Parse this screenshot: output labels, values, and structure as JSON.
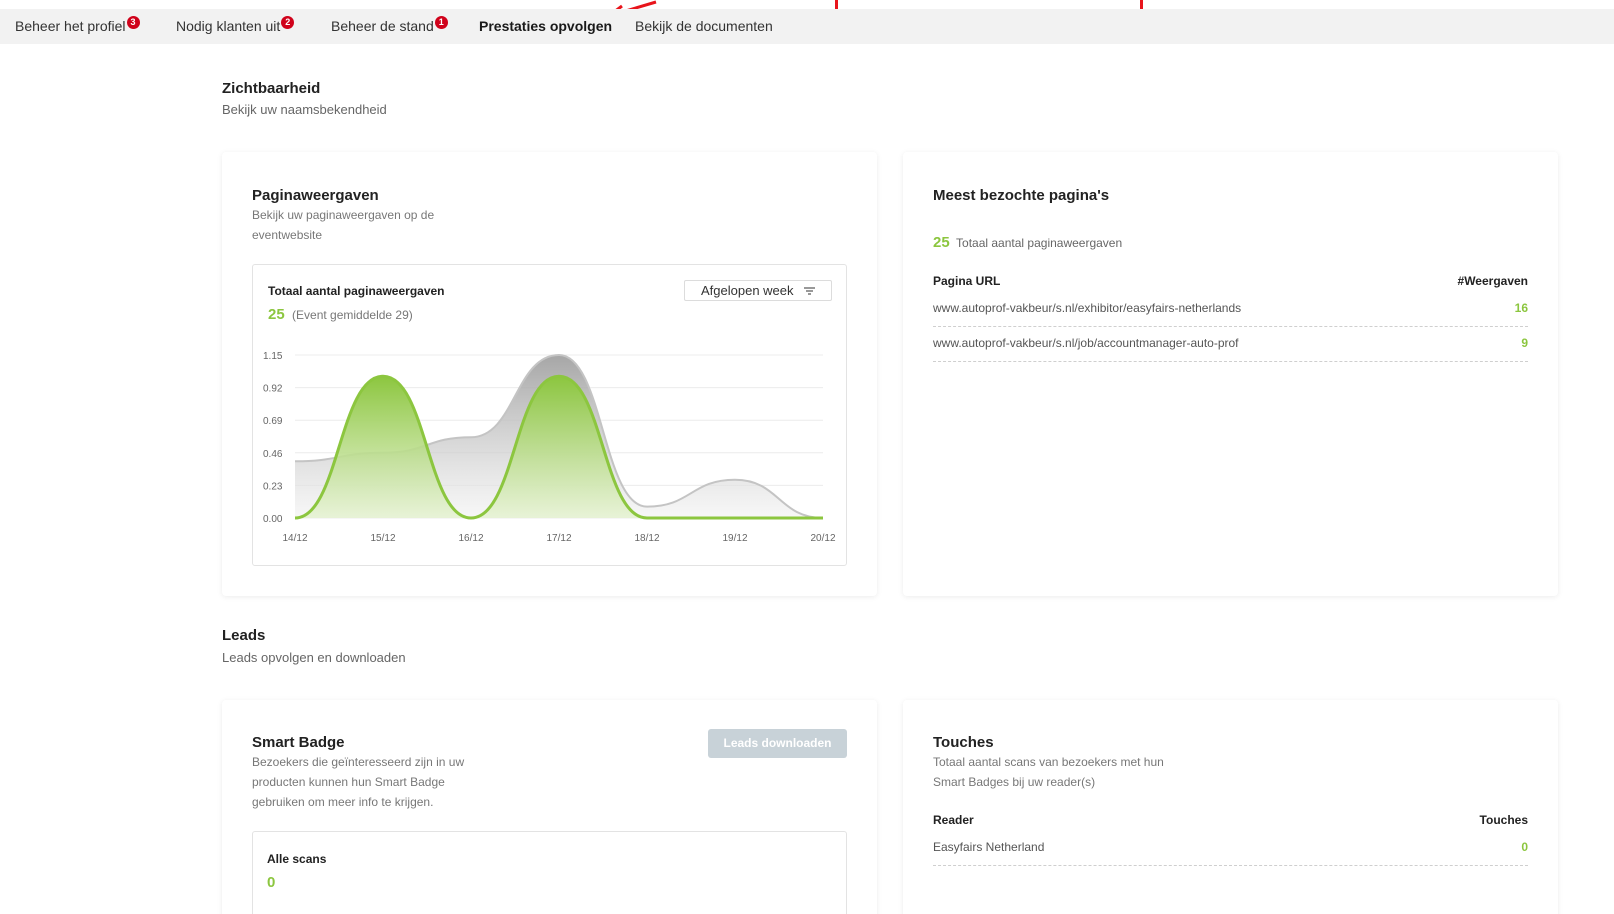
{
  "nav": {
    "tabs": [
      {
        "label": "Beheer het profiel",
        "badge": "3"
      },
      {
        "label": "Nodig klanten uit",
        "badge": "2"
      },
      {
        "label": "Beheer de stand",
        "badge": "1"
      },
      {
        "label": "Prestaties opvolgen"
      },
      {
        "label": "Bekijk de documenten"
      }
    ],
    "active_index": 3
  },
  "visibility": {
    "title": "Zichtbaarheid",
    "subtitle": "Bekijk uw naamsbekendheid"
  },
  "pageviews": {
    "title": "Paginaweergaven",
    "subtitle_line1": "Bekijk uw paginaweergaven op de",
    "subtitle_line2": "eventwebsite",
    "chart_title": "Totaal aantal paginaweergaven",
    "total": "25",
    "average": "(Event gemiddelde 29)",
    "period": "Afgelopen week"
  },
  "chart_data": {
    "type": "area",
    "title": "Totaal aantal paginaweergaven",
    "categories": [
      "14/12",
      "15/12",
      "16/12",
      "17/12",
      "18/12",
      "19/12",
      "20/12"
    ],
    "y_ticks": [
      "1.15",
      "0.92",
      "0.69",
      "0.46",
      "0.23",
      "0.00"
    ],
    "ylim": [
      0,
      1.15
    ],
    "series": [
      {
        "values": [
          0.4,
          0.46,
          0.57,
          1.15,
          0.08,
          0.27,
          0.0
        ],
        "color": "#c9c9c9"
      },
      {
        "values": [
          0.0,
          1.0,
          0.0,
          1.0,
          0.0,
          0.0,
          0.0
        ],
        "color": "#8cc63f"
      }
    ],
    "grid": true
  },
  "most_visited": {
    "title": "Meest bezochte pagina's",
    "total": "25",
    "total_label": "Totaal aantal paginaweergaven",
    "col_url": "Pagina URL",
    "col_views": "#Weergaven",
    "rows": [
      {
        "url": "www.autoprof-vakbeur/s.nl/exhibitor/easyfairs-netherlands",
        "views": "16"
      },
      {
        "url": "www.autoprof-vakbeur/s.nl/job/accountmanager-auto-prof",
        "views": "9"
      }
    ]
  },
  "leads": {
    "title": "Leads",
    "subtitle": "Leads opvolgen en downloaden"
  },
  "smart_badge": {
    "title": "Smart Badge",
    "line1": "Bezoekers die geïnteresseerd zijn in uw",
    "line2": "producten kunnen hun Smart Badge",
    "line3": "gebruiken om meer info te krijgen.",
    "download_label": "Leads downloaden",
    "all_scans_label": "Alle scans",
    "all_scans_value": "0"
  },
  "touches": {
    "title": "Touches",
    "line1": "Totaal aantal scans van bezoekers met hun",
    "line2": "Smart Badges bij uw reader(s)",
    "col_reader": "Reader",
    "col_touches": "Touches",
    "rows": [
      {
        "reader": "Easyfairs Netherland",
        "touches": "0"
      }
    ]
  },
  "colors": {
    "accent_green": "#8cc63f",
    "badge_red": "#d0021b",
    "annotation_red": "#e8141b"
  }
}
